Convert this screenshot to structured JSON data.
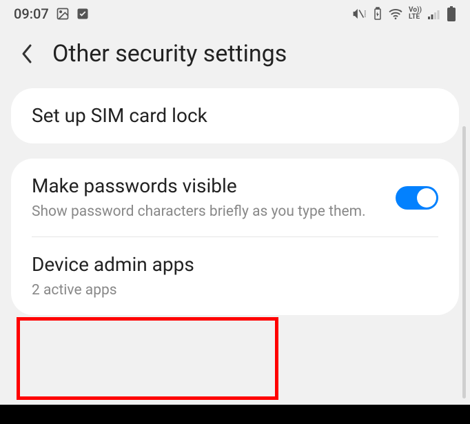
{
  "status_bar": {
    "time": "09:07"
  },
  "header": {
    "title": "Other security settings"
  },
  "sections": [
    {
      "items": [
        {
          "title": "Set up SIM card lock"
        }
      ]
    },
    {
      "items": [
        {
          "title": "Make passwords visible",
          "subtitle": "Show password characters briefly as you type them.",
          "toggle": true
        },
        {
          "title": "Device admin apps",
          "subtitle": "2 active apps"
        }
      ]
    }
  ],
  "volte": {
    "line1": "Vo))",
    "line2": "LTE"
  }
}
